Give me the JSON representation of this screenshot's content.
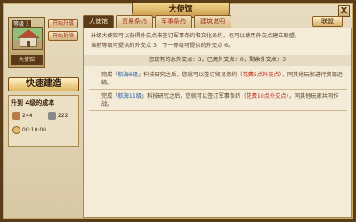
{
  "window": {
    "title": "大使馆",
    "close_label": "X"
  },
  "building": {
    "level_label": "等级 3",
    "name": "大使馆",
    "upgrade_button": "开始升级",
    "demolish_button": "开始拆除",
    "speed_button": "快速建造"
  },
  "cost": {
    "title": "升到 4级的成本",
    "resource_a": "244",
    "resource_b": "222",
    "time": "00:10:00"
  },
  "tabs": [
    {
      "label": "大使馆",
      "active": true
    },
    {
      "label": "贸易条约",
      "active": false
    },
    {
      "label": "军事条约",
      "active": false
    },
    {
      "label": "建筑说明",
      "active": false
    }
  ],
  "alliance_button": "联盟",
  "content": {
    "intro_line1": "升级大使馆可以获得外交点来签订军事条约和文化条约，也可以使用外交点建立联盟。",
    "intro_line2": "当前等级可提供的外交点 3，下一等级可提供的外交点 6。",
    "summary": "您现有的总外交点：3，已用外交点：0，剩余外交点：3",
    "req1": {
      "pre": "完成「",
      "tech": "航海6级",
      "mid": "」科技研究之后，您就可以签订贸易条约（",
      "cost": "花费5点外交点",
      "post": "），同其他玩家进行资源运输。"
    },
    "req2": {
      "pre": "完成「",
      "tech": "航海11级",
      "mid": "」科技研究之后，您就可以签订军事条约（",
      "cost": "花费10点外交点",
      "post": "），同其他玩家共同作战。"
    }
  },
  "colors": {
    "frame": "#5a3c18",
    "panel": "#f4ecd8",
    "accent_red": "#c02818",
    "accent_blue": "#1a5aa8"
  }
}
